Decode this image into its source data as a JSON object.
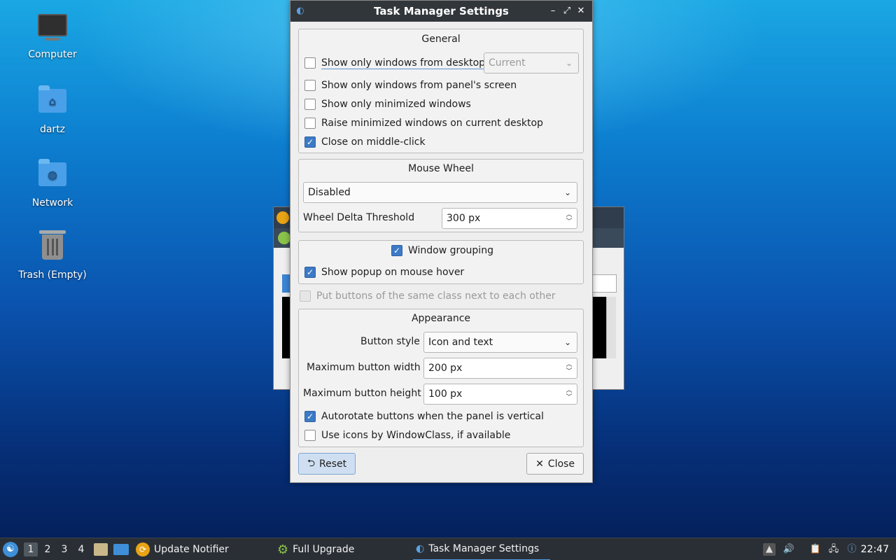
{
  "desktop": {
    "icons": [
      {
        "label": "Computer",
        "icon": "computer-icon"
      },
      {
        "label": "dartz",
        "icon": "home-folder-icon"
      },
      {
        "label": "Network",
        "icon": "network-folder-icon"
      },
      {
        "label": "Trash (Empty)",
        "icon": "trash-icon"
      }
    ]
  },
  "dialog": {
    "title": "Task Manager Settings",
    "general": {
      "title": "General",
      "desktop_only": {
        "label": "Show only windows from desktop",
        "checked": false
      },
      "desktop_combo": {
        "value": "Current",
        "enabled": false
      },
      "panel_screen": {
        "label": "Show only windows from panel's screen",
        "checked": false
      },
      "minimized_only": {
        "label": "Show only minimized windows",
        "checked": false
      },
      "raise_minimized": {
        "label": "Raise minimized windows on current desktop",
        "checked": false
      },
      "close_middle": {
        "label": "Close on middle-click",
        "checked": true
      }
    },
    "mouse_wheel": {
      "title": "Mouse Wheel",
      "mode": "Disabled",
      "threshold_label": "Wheel Delta Threshold",
      "threshold_value": "300 px"
    },
    "grouping": {
      "window_grouping": {
        "label": "Window grouping",
        "checked": true
      },
      "popup_hover": {
        "label": "Show popup on mouse hover",
        "checked": true
      }
    },
    "same_class": {
      "label": "Put buttons of the same class next to each other",
      "checked": false,
      "enabled": false
    },
    "appearance": {
      "title": "Appearance",
      "button_style_label": "Button style",
      "button_style_value": "Icon and text",
      "max_width_label": "Maximum button width",
      "max_width_value": "200 px",
      "max_height_label": "Maximum button height",
      "max_height_value": "100 px",
      "autorotate": {
        "label": "Autorotate buttons when the panel is vertical",
        "checked": true
      },
      "window_class": {
        "label": "Use icons by WindowClass, if available",
        "checked": false
      }
    },
    "buttons": {
      "reset": "Reset",
      "close": "Close"
    }
  },
  "taskbar": {
    "workspaces": [
      "1",
      "2",
      "3",
      "4"
    ],
    "active_workspace": "1",
    "tasks": [
      {
        "label": "Update Notifier",
        "icon": "update-notifier-icon"
      },
      {
        "label": "Full Upgrade",
        "icon": "gear-icon"
      },
      {
        "label": "Task Manager Settings",
        "icon": "lxqt-icon",
        "active": true
      }
    ],
    "clock": "22:47"
  },
  "colors": {
    "accent": "#3c7ac6",
    "titlebar": "#31363b",
    "taskbar": "#2a2f35"
  }
}
